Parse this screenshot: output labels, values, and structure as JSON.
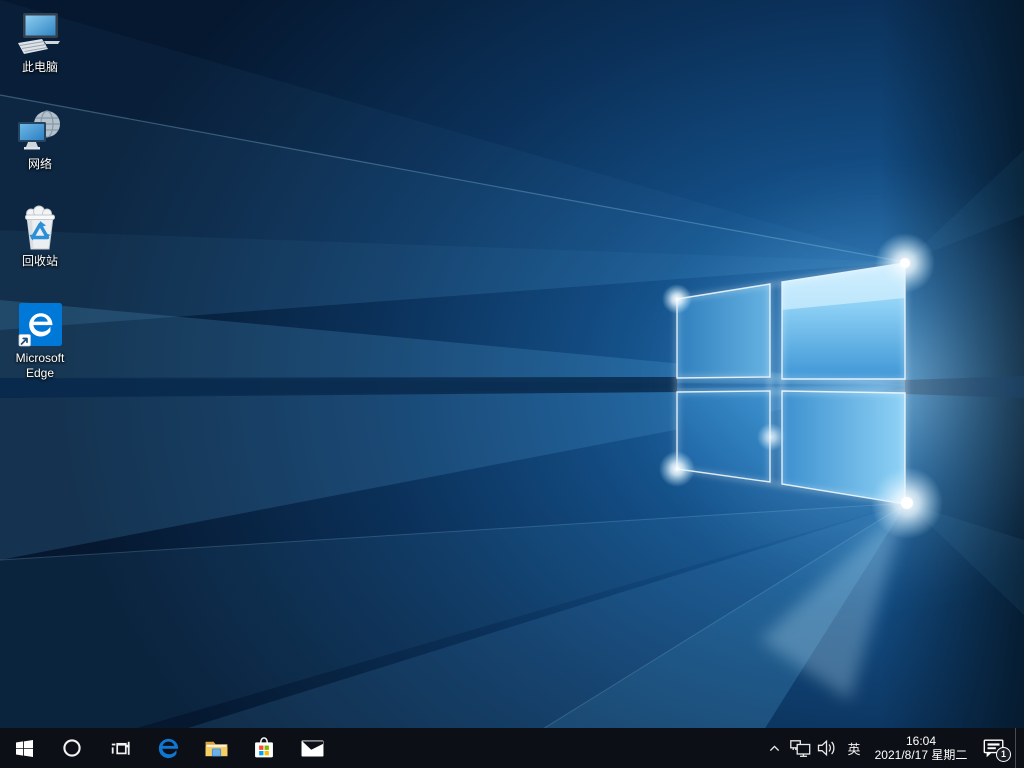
{
  "desktop": {
    "icons": [
      {
        "id": "this-pc",
        "label": "此电脑"
      },
      {
        "id": "network",
        "label": "网络"
      },
      {
        "id": "recycle-bin",
        "label": "回收站"
      },
      {
        "id": "microsoft-edge",
        "label": "Microsoft Edge"
      }
    ]
  },
  "taskbar": {
    "buttons": [
      {
        "id": "start",
        "icon": "windows-logo-icon"
      },
      {
        "id": "cortana-search",
        "icon": "cortana-circle-icon"
      },
      {
        "id": "task-view",
        "icon": "task-view-icon"
      },
      {
        "id": "edge",
        "icon": "edge-e-icon"
      },
      {
        "id": "file-explorer",
        "icon": "folder-icon"
      },
      {
        "id": "store",
        "icon": "store-bag-icon"
      },
      {
        "id": "mail",
        "icon": "mail-envelope-icon"
      }
    ],
    "tray": {
      "hidden_icons": "^",
      "ime": "英",
      "time": "16:04",
      "date": "2021/8/17 星期二",
      "notification_badge": "1"
    }
  },
  "colors": {
    "taskbar_background": "#0c1016",
    "wallpaper_primary_blue": "#1f71b8",
    "wallpaper_dark_navy": "#071c33",
    "edge_blue": "#0078d7",
    "ms_red": "#f25022",
    "ms_green": "#7fba00",
    "ms_blue": "#00a4ef",
    "ms_yellow": "#ffb900"
  }
}
